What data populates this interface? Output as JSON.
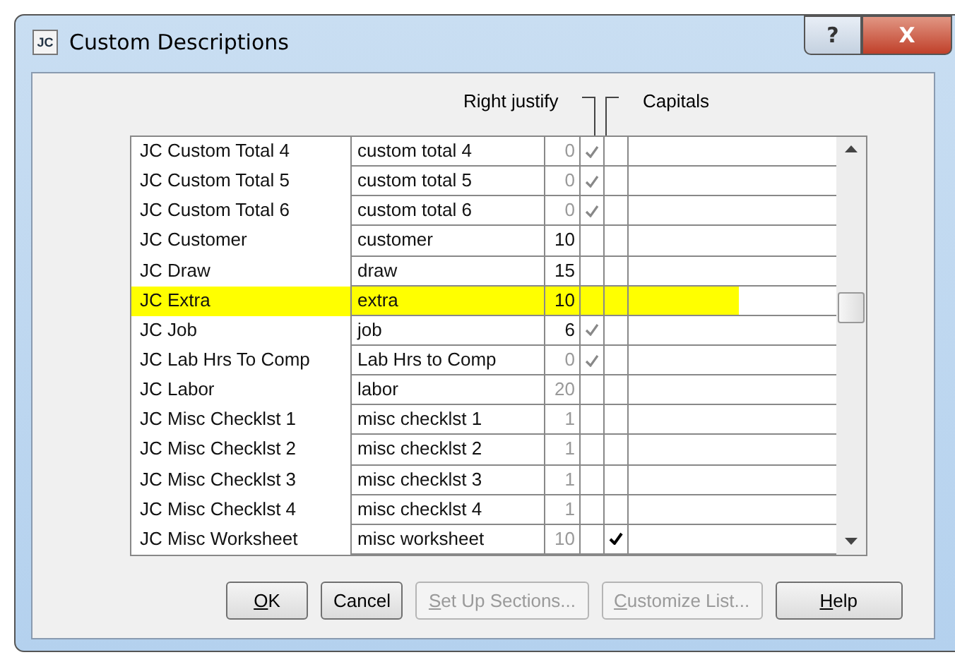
{
  "window": {
    "title": "Custom Descriptions",
    "icon_text": "JC",
    "help_glyph": "?",
    "close_glyph": "X"
  },
  "headers": {
    "right_justify": "Right justify",
    "capitals": "Capitals"
  },
  "rows": [
    {
      "name": "JC Custom Total 4",
      "description": "custom total 4",
      "length": "0",
      "length_disabled": true,
      "right_justify": true,
      "capitals": false,
      "highlighted": false
    },
    {
      "name": "JC Custom Total 5",
      "description": "custom total 5",
      "length": "0",
      "length_disabled": true,
      "right_justify": true,
      "capitals": false,
      "highlighted": false
    },
    {
      "name": "JC Custom Total 6",
      "description": "custom total 6",
      "length": "0",
      "length_disabled": true,
      "right_justify": true,
      "capitals": false,
      "highlighted": false
    },
    {
      "name": "JC Customer",
      "description": "customer",
      "length": "10",
      "length_disabled": false,
      "right_justify": false,
      "capitals": false,
      "highlighted": false
    },
    {
      "name": "JC Draw",
      "description": "draw",
      "length": "15",
      "length_disabled": false,
      "right_justify": false,
      "capitals": false,
      "highlighted": false
    },
    {
      "name": "JC Extra",
      "description": "extra",
      "length": "10",
      "length_disabled": false,
      "right_justify": false,
      "capitals": false,
      "highlighted": true
    },
    {
      "name": "JC Job",
      "description": "job",
      "length": "6",
      "length_disabled": false,
      "right_justify": true,
      "capitals": false,
      "highlighted": false
    },
    {
      "name": "JC Lab Hrs To Comp",
      "description": "Lab Hrs to Comp",
      "length": "0",
      "length_disabled": true,
      "right_justify": true,
      "capitals": false,
      "highlighted": false
    },
    {
      "name": "JC Labor",
      "description": "labor",
      "length": "20",
      "length_disabled": true,
      "right_justify": false,
      "capitals": false,
      "highlighted": false
    },
    {
      "name": "JC Misc Checklst 1",
      "description": "misc checklst 1",
      "length": "1",
      "length_disabled": true,
      "right_justify": false,
      "capitals": false,
      "highlighted": false
    },
    {
      "name": "JC Misc Checklst 2",
      "description": "misc checklst 2",
      "length": "1",
      "length_disabled": true,
      "right_justify": false,
      "capitals": false,
      "highlighted": false
    },
    {
      "name": "JC Misc Checklst 3",
      "description": "misc checklst 3",
      "length": "1",
      "length_disabled": true,
      "right_justify": false,
      "capitals": false,
      "highlighted": false
    },
    {
      "name": "JC Misc Checklst 4",
      "description": "misc checklst 4",
      "length": "1",
      "length_disabled": true,
      "right_justify": false,
      "capitals": false,
      "highlighted": false
    },
    {
      "name": "JC Misc Worksheet",
      "description": "misc worksheet",
      "length": "10",
      "length_disabled": true,
      "right_justify": false,
      "capitals": true,
      "highlighted": false
    }
  ],
  "buttons": [
    {
      "label": "OK",
      "underline_first": true,
      "disabled": false
    },
    {
      "label": "Cancel",
      "underline_first": false,
      "disabled": false
    },
    {
      "label": "Set Up Sections...",
      "underline_first": true,
      "disabled": true
    },
    {
      "label": "Customize List...",
      "underline_first": true,
      "disabled": true
    },
    {
      "label": "Help",
      "underline_first": true,
      "disabled": false
    }
  ]
}
